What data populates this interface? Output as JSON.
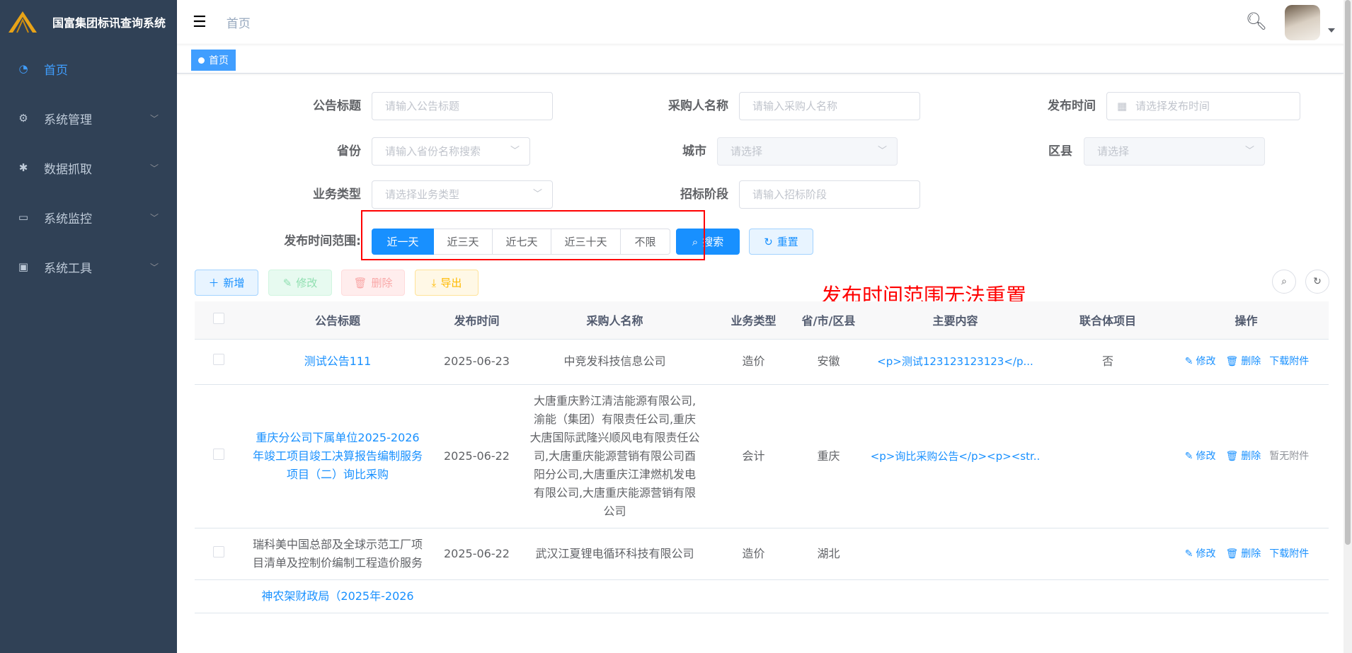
{
  "app_title": "国富集团标讯查询系统",
  "sidebar": {
    "items": [
      {
        "label": "首页",
        "icon": "dashboard-icon",
        "glyph": "◔",
        "active": true
      },
      {
        "label": "系统管理",
        "icon": "gear-icon",
        "glyph": "⚙"
      },
      {
        "label": "数据抓取",
        "icon": "bug-icon",
        "glyph": "✱"
      },
      {
        "label": "系统监控",
        "icon": "monitor-icon",
        "glyph": "▭"
      },
      {
        "label": "系统工具",
        "icon": "toolbox-icon",
        "glyph": "▣"
      }
    ]
  },
  "header": {
    "breadcrumb": "首页"
  },
  "tags": {
    "active": "首页"
  },
  "form": {
    "title_label": "公告标题",
    "title_ph": "请输入公告标题",
    "buyer_label": "采购人名称",
    "buyer_ph": "请输入采购人名称",
    "pubtime_label": "发布时间",
    "pubtime_ph": "请选择发布时间",
    "province_label": "省份",
    "province_ph": "请输入省份名称搜索",
    "city_label": "城市",
    "city_ph": "请选择",
    "district_label": "区县",
    "district_ph": "请选择",
    "biz_label": "业务类型",
    "biz_ph": "请选择业务类型",
    "stage_label": "招标阶段",
    "stage_ph": "请输入招标阶段",
    "range_label": "发布时间范围:",
    "ranges": [
      "近一天",
      "近三天",
      "近七天",
      "近三十天",
      "不限"
    ],
    "range_selected": "近一天",
    "search": "搜索",
    "reset": "重置"
  },
  "toolbar": {
    "add": "新增",
    "edit": "修改",
    "delete": "删除",
    "export": "导出"
  },
  "annotation": "发布时间范围无法重置",
  "colors": {
    "sidebar": "#304156",
    "primary": "#1890ff",
    "annotation": "#ff0000"
  },
  "table": {
    "headers": [
      "公告标题",
      "发布时间",
      "采购人名称",
      "业务类型",
      "省/市/区县",
      "主要内容",
      "联合体项目",
      "操作"
    ],
    "rows": [
      {
        "title": "测试公告111",
        "title_link": true,
        "date": "2025-06-23",
        "buyer": "中竞发科技信息公司",
        "type": "造价",
        "region": "安徽",
        "content": "<p>测试123123123123</p...",
        "joint": "否",
        "edit": "修改",
        "del": "删除",
        "attach": "下载附件",
        "attach_dim": false
      },
      {
        "title": "重庆分公司下属单位2025-2026年竣工项目竣工决算报告编制服务项目（二）询比采购",
        "title_link": true,
        "date": "2025-06-22",
        "buyer": "大唐重庆黔江清洁能源有限公司,渝能（集团）有限责任公司,重庆大唐国际武隆兴顺风电有限责任公司,大唐重庆能源营销有限公司酉阳分公司,大唐重庆江津燃机发电有限公司,大唐重庆能源营销有限公司",
        "type": "会计",
        "region": "重庆",
        "content": "<p>询比采购公告</p><p><str..",
        "joint": "",
        "edit": "修改",
        "del": "删除",
        "attach": "暂无附件",
        "attach_dim": true
      },
      {
        "title": "瑞科美中国总部及全球示范工厂项目清单及控制价编制工程造价服务",
        "title_link": false,
        "date": "2025-06-22",
        "buyer": "武汉江夏锂电循环科技有限公司",
        "type": "造价",
        "region": "湖北",
        "content": "",
        "joint": "",
        "edit": "修改",
        "del": "删除",
        "attach": "下载附件",
        "attach_dim": false
      },
      {
        "title": "神农架财政局（2025年-2026",
        "title_link": true,
        "date": "",
        "buyer": "",
        "type": "",
        "region": "",
        "content": "",
        "joint": "",
        "edit": "",
        "del": "",
        "attach": "",
        "attach_dim": false
      }
    ]
  }
}
